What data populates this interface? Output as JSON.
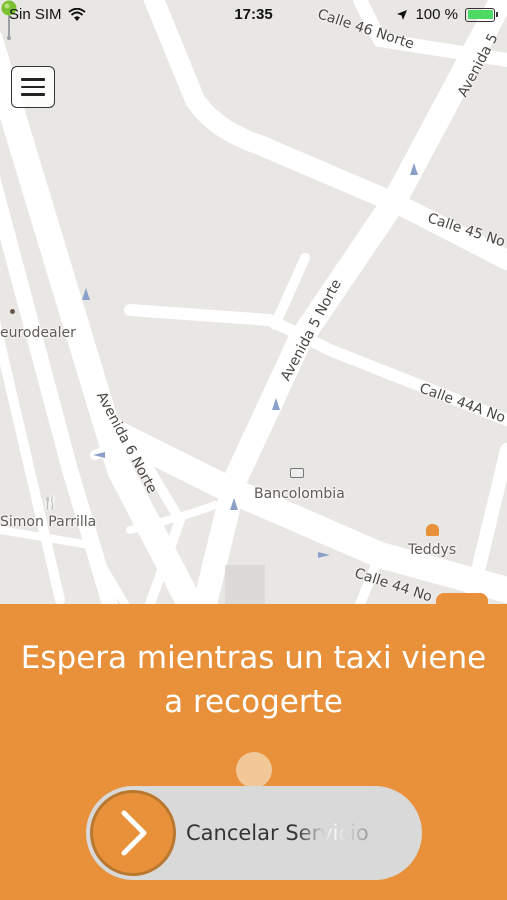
{
  "status_bar": {
    "carrier": "Sin SIM",
    "time": "17:35",
    "battery_percent": "100 %",
    "battery_level": 1.0,
    "battery_color": "#4cd964"
  },
  "menu": {
    "icon": "hamburger-menu-icon"
  },
  "map": {
    "streets": {
      "calle_46": "Calle 46 Norte",
      "calle_45": "Calle 45 No",
      "calle_44a": "Calle 44A No",
      "calle_44": "Calle 44 No",
      "avenida_5": "Avenida 5 Norte",
      "avenida_6": "Avenida 6 Norte",
      "avenida_top": "Avenida 5"
    },
    "places": {
      "eurodealer": "eurodealer",
      "bancolombia": "Bancolombia",
      "simon_parrilla": "Simon Parrilla",
      "teddys": "Teddys"
    },
    "pin_color": "#7ac231"
  },
  "sheet": {
    "message": "Espera mientras un taxi viene a recogerte",
    "accent_color": "#e8913a",
    "slider": {
      "label": "Cancelar Servicio",
      "icon": "chevron-right-icon"
    }
  }
}
